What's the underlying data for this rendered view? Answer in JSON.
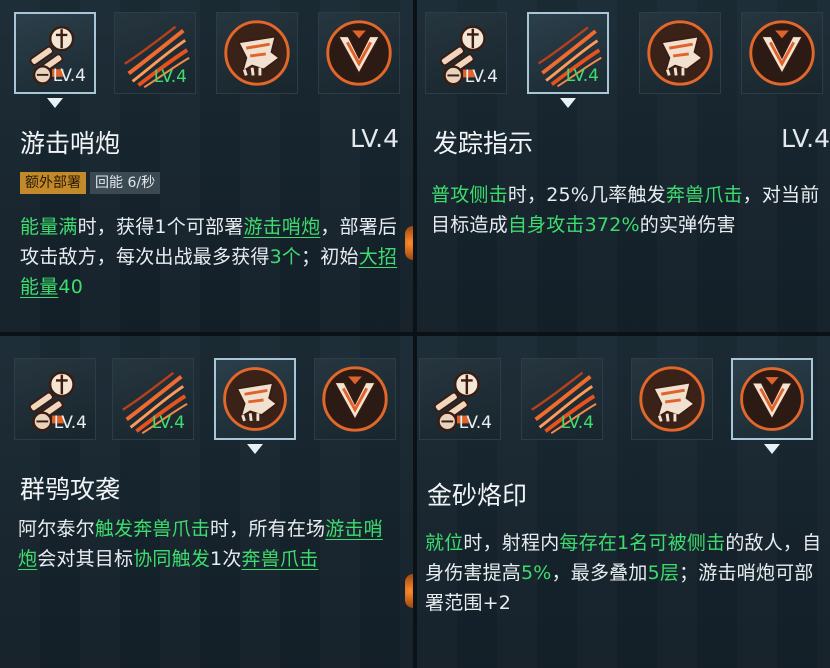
{
  "panels": [
    {
      "title": "游击哨炮",
      "level": "LV.4",
      "tags": [
        "额外部署",
        "回能 6/秒"
      ],
      "icons": [
        {
          "name": "turret-skill-icon",
          "level": "LV.4",
          "level_color": "white"
        },
        {
          "name": "claw-strike-icon",
          "level": "LV.4",
          "level_color": "green"
        },
        {
          "name": "beast-crest-icon",
          "level": "",
          "level_color": "white"
        },
        {
          "name": "chevron-emblem-icon",
          "level": "",
          "level_color": "white"
        }
      ],
      "desc_segments": [
        {
          "t": "能量满",
          "c": "g"
        },
        {
          "t": "时，获得1个可部署"
        },
        {
          "t": "游击哨炮",
          "c": "g u"
        },
        {
          "t": "，部署后攻击敌方，每次出战最多获得"
        },
        {
          "t": "3个",
          "c": "g"
        },
        {
          "t": "；初始"
        },
        {
          "t": "大招能量",
          "c": "g u"
        },
        {
          "t": "40",
          "c": "g"
        }
      ]
    },
    {
      "title": "发踪指示",
      "level": "LV.4",
      "tags": [],
      "icons": [
        {
          "name": "turret-skill-icon",
          "level": "LV.4",
          "level_color": "white"
        },
        {
          "name": "claw-strike-icon",
          "level": "LV.4",
          "level_color": "green"
        },
        {
          "name": "beast-crest-icon",
          "level": "",
          "level_color": "white"
        },
        {
          "name": "chevron-emblem-icon",
          "level": "",
          "level_color": "white"
        }
      ],
      "desc_segments": [
        {
          "t": "普攻侧击",
          "c": "g"
        },
        {
          "t": "时，25%几率触发"
        },
        {
          "t": "奔兽爪击",
          "c": "g"
        },
        {
          "t": "，对当前目标造成"
        },
        {
          "t": "自身攻击372%",
          "c": "g"
        },
        {
          "t": "的实弹伤害"
        }
      ]
    },
    {
      "title": "群鸮攻袭",
      "level": "",
      "tags": [],
      "icons": [
        {
          "name": "turret-skill-icon",
          "level": "LV.4",
          "level_color": "white"
        },
        {
          "name": "claw-strike-icon",
          "level": "LV.4",
          "level_color": "green"
        },
        {
          "name": "beast-crest-icon",
          "level": "",
          "level_color": "white"
        },
        {
          "name": "chevron-emblem-icon",
          "level": "",
          "level_color": "white"
        }
      ],
      "desc_segments": [
        {
          "t": "阿尔泰尔"
        },
        {
          "t": "触发奔兽爪击",
          "c": "g"
        },
        {
          "t": "时，所有在场"
        },
        {
          "t": "游击哨炮",
          "c": "g u"
        },
        {
          "t": "会对其目标"
        },
        {
          "t": "协同触发",
          "c": "g"
        },
        {
          "t": "1次"
        },
        {
          "t": "奔兽爪击",
          "c": "g u"
        }
      ]
    },
    {
      "title": "金砂烙印",
      "level": "",
      "tags": [],
      "icons": [
        {
          "name": "turret-skill-icon",
          "level": "LV.4",
          "level_color": "white"
        },
        {
          "name": "claw-strike-icon",
          "level": "LV.4",
          "level_color": "green"
        },
        {
          "name": "beast-crest-icon",
          "level": "",
          "level_color": "white"
        },
        {
          "name": "chevron-emblem-icon",
          "level": "",
          "level_color": "white"
        }
      ],
      "desc_segments": [
        {
          "t": "就位",
          "c": "g"
        },
        {
          "t": "时，射程内"
        },
        {
          "t": "每存在1名可被侧击",
          "c": "g"
        },
        {
          "t": "的敌人，自身伤害提高"
        },
        {
          "t": "5%",
          "c": "g"
        },
        {
          "t": "，最多叠加"
        },
        {
          "t": "5层",
          "c": "g"
        },
        {
          "t": "；游击哨炮可部署范围+2"
        }
      ]
    }
  ]
}
